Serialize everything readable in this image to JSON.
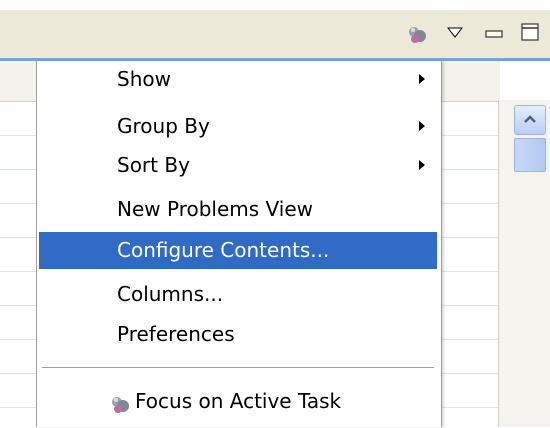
{
  "toolbar": {
    "icons": [
      "focus-task-icon",
      "view-menu-triangle-icon",
      "minimize-icon",
      "maximize-icon"
    ]
  },
  "menu": {
    "items": [
      {
        "label": "Show",
        "submenu": true
      },
      {
        "label": "Group By",
        "submenu": true
      },
      {
        "label": "Sort By",
        "submenu": true
      },
      {
        "label": "New Problems View",
        "submenu": false
      },
      {
        "label": "Configure Contents...",
        "submenu": false,
        "selected": true
      },
      {
        "label": "Columns...",
        "submenu": false
      },
      {
        "label": "Preferences",
        "submenu": false
      }
    ],
    "after_separator": [
      {
        "label": "Focus on Active Task",
        "icon": "focus-task-icon"
      }
    ]
  },
  "colors": {
    "selection": "#316ac5",
    "toolbar_bg": "#ece9d8",
    "accent_line": "#7f9fd8"
  }
}
